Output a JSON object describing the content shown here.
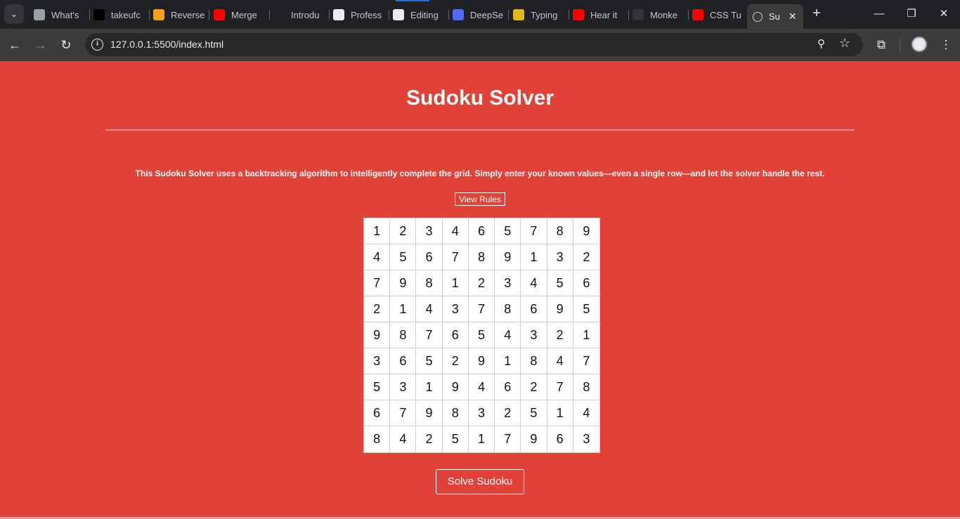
{
  "browser": {
    "tabs": [
      {
        "title": "What's",
        "icon": "chrome-icon",
        "color": "#9aa0a6"
      },
      {
        "title": "takeufc",
        "icon": "tuf-icon",
        "color": "#000000"
      },
      {
        "title": "Reverse",
        "icon": "ladder-icon",
        "color": "#f6a01a"
      },
      {
        "title": "Merge",
        "icon": "youtube-icon",
        "color": "#ff0000"
      },
      {
        "title": "Introdu",
        "icon": "openai-icon",
        "color": "#202124"
      },
      {
        "title": "Profess",
        "icon": "openai-icon",
        "color": "#e8eaed"
      },
      {
        "title": "Editing",
        "icon": "github-icon",
        "color": "#e8eaed"
      },
      {
        "title": "DeepSe",
        "icon": "deepseek-icon",
        "color": "#4d6bfe"
      },
      {
        "title": "Typing",
        "icon": "typing-icon",
        "color": "#e2b714"
      },
      {
        "title": "Hear it",
        "icon": "youtube-icon",
        "color": "#ff0000"
      },
      {
        "title": "Monke",
        "icon": "monkeytype-icon",
        "color": "#323437"
      },
      {
        "title": "CSS Tu",
        "icon": "youtube-icon",
        "color": "#ff0000"
      }
    ],
    "active_tab": {
      "title": "Su",
      "icon": "globe-icon"
    },
    "url": "127.0.0.1:5500/index.html"
  },
  "page": {
    "title": "Sudoku Solver",
    "description": "This Sudoku Solver uses a backtracking algorithm to intelligently complete the grid. Simply enter your known values—even a single row—and let the solver handle the rest.",
    "rules_button": "View Rules",
    "solve_button": "Solve Sudoku",
    "grid": [
      [
        1,
        2,
        3,
        4,
        6,
        5,
        7,
        8,
        9
      ],
      [
        4,
        5,
        6,
        7,
        8,
        9,
        1,
        3,
        2
      ],
      [
        7,
        9,
        8,
        1,
        2,
        3,
        4,
        5,
        6
      ],
      [
        2,
        1,
        4,
        3,
        7,
        8,
        6,
        9,
        5
      ],
      [
        9,
        8,
        7,
        6,
        5,
        4,
        3,
        2,
        1
      ],
      [
        3,
        6,
        5,
        2,
        9,
        1,
        8,
        4,
        7
      ],
      [
        5,
        3,
        1,
        9,
        4,
        6,
        2,
        7,
        8
      ],
      [
        6,
        7,
        9,
        8,
        3,
        2,
        5,
        1,
        4
      ],
      [
        8,
        4,
        2,
        5,
        1,
        7,
        9,
        6,
        3
      ]
    ]
  },
  "colors": {
    "background": "#e14136",
    "text": "#ffffff",
    "grid_cell": "#ffffff"
  }
}
